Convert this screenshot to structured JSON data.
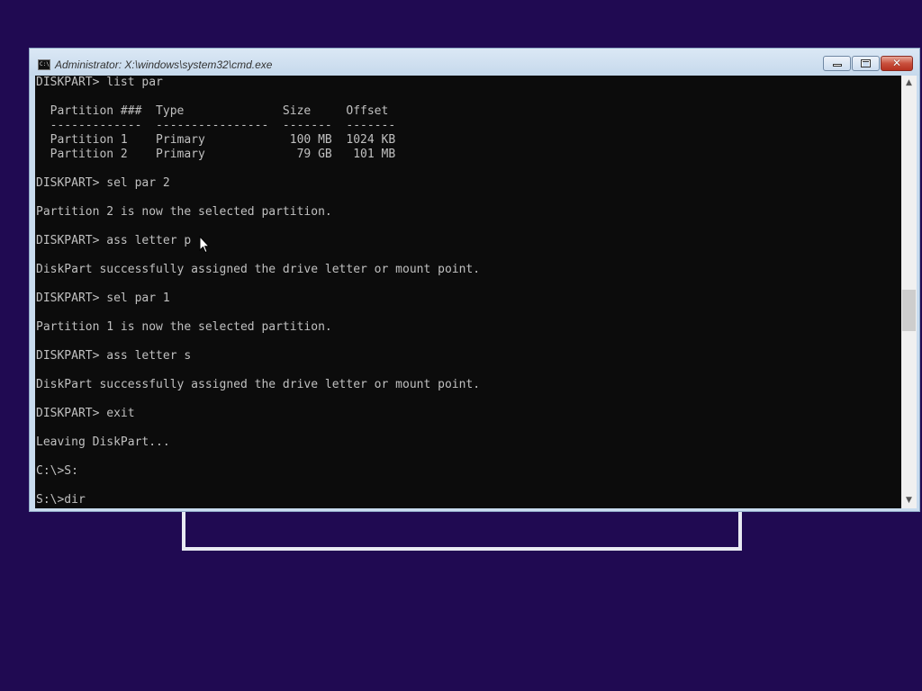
{
  "window": {
    "title": "Administrator: X:\\windows\\system32\\cmd.exe",
    "icon_label": "C:\\",
    "close_glyph": "✕"
  },
  "scrollbar": {
    "up_arrow": "▲",
    "down_arrow": "▼",
    "position_fraction": 0.55
  },
  "console": {
    "lines": [
      "DISKPART> list par",
      "",
      "  Partition ###  Type              Size     Offset",
      "  -------------  ----------------  -------  -------",
      "  Partition 1    Primary            100 MB  1024 KB",
      "  Partition 2    Primary             79 GB   101 MB",
      "",
      "DISKPART> sel par 2",
      "",
      "Partition 2 is now the selected partition.",
      "",
      "DISKPART> ass letter p",
      "",
      "DiskPart successfully assigned the drive letter or mount point.",
      "",
      "DISKPART> sel par 1",
      "",
      "Partition 1 is now the selected partition.",
      "",
      "DISKPART> ass letter s",
      "",
      "DiskPart successfully assigned the drive letter or mount point.",
      "",
      "DISKPART> exit",
      "",
      "Leaving DiskPart...",
      "",
      "C:\\>S:",
      "",
      "S:\\>dir"
    ]
  },
  "colors": {
    "desktop_background": "#200a52",
    "console_background": "#0c0c0c",
    "console_text": "#c0c0c0",
    "title_bar": "#c9dcef",
    "close_button": "#c9503d"
  },
  "icons": {
    "app": "cmd-icon",
    "minimize": "minimize-icon",
    "maximize": "maximize-icon",
    "close": "close-icon",
    "cursor": "mouse-pointer-icon"
  }
}
